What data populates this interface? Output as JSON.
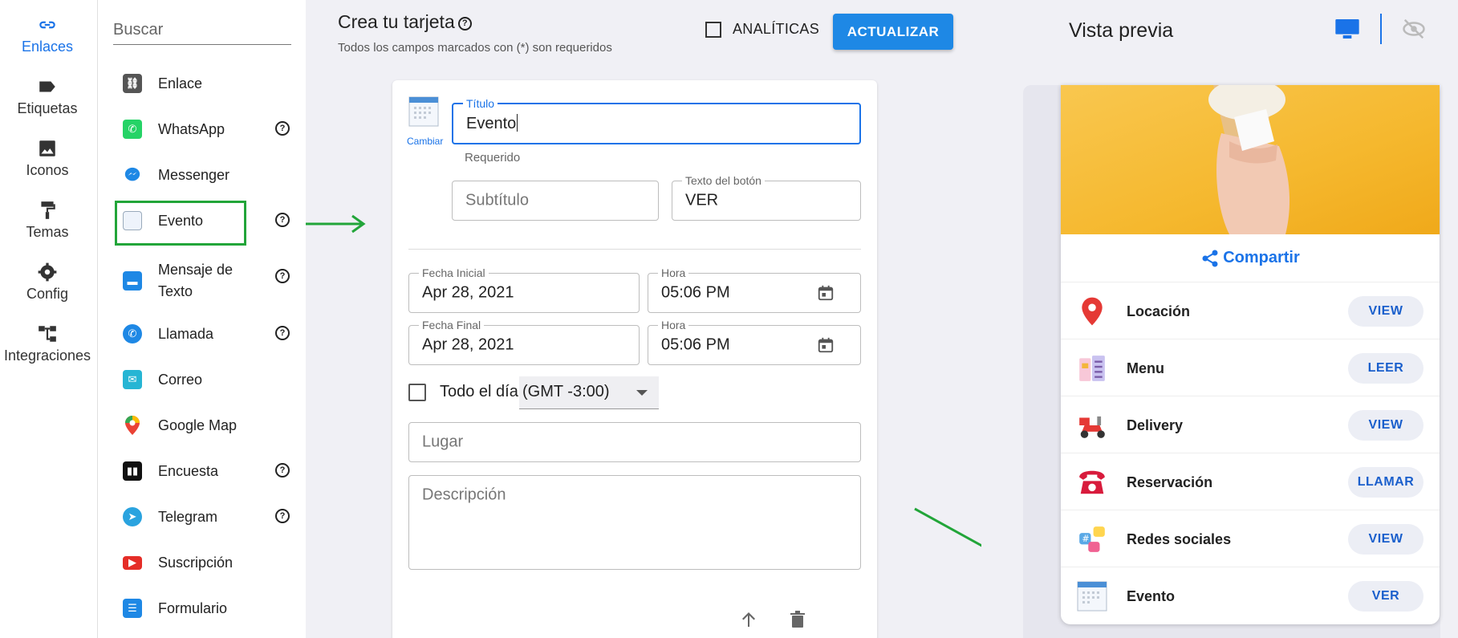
{
  "rail": {
    "items": [
      {
        "label": "Enlaces",
        "icon": "link-icon",
        "active": true
      },
      {
        "label": "Etiquetas",
        "icon": "tag-icon"
      },
      {
        "label": "Iconos",
        "icon": "image-icon"
      },
      {
        "label": "Temas",
        "icon": "paint-roller-icon"
      },
      {
        "label": "Config",
        "icon": "gear-icon"
      },
      {
        "label": "Integraciones",
        "icon": "hierarchy-icon"
      }
    ]
  },
  "types": {
    "search_placeholder": "Buscar",
    "items": [
      {
        "label": "Enlace",
        "icon": "link-icon",
        "color": "#555555"
      },
      {
        "label": "WhatsApp",
        "icon": "whatsapp-icon",
        "color": "#25d366",
        "help": true
      },
      {
        "label": "Messenger",
        "icon": "messenger-icon",
        "color": "#1e88e5"
      },
      {
        "label": "Evento",
        "icon": "calendar-icon",
        "color": "#e8eef8",
        "help": true
      },
      {
        "label": "Mensaje de",
        "label2": "Texto",
        "icon": "sms-icon",
        "color": "#1e88e5",
        "help": true
      },
      {
        "label": "Llamada",
        "icon": "phone-icon",
        "color": "#1e88e5",
        "help": true
      },
      {
        "label": "Correo",
        "icon": "mail-icon",
        "color": "#26b5d4"
      },
      {
        "label": "Google Map",
        "icon": "map-pin-icon",
        "color": "#ea4335"
      },
      {
        "label": "Encuesta",
        "icon": "poll-icon",
        "color": "#111111",
        "help": true
      },
      {
        "label": "Telegram",
        "icon": "telegram-icon",
        "color": "#2aa3df",
        "help": true
      },
      {
        "label": "Suscripción",
        "icon": "youtube-icon",
        "color": "#e52d27"
      },
      {
        "label": "Formulario",
        "icon": "form-icon",
        "color": "#1e88e5"
      }
    ]
  },
  "editor": {
    "title": "Crea tu tarjeta",
    "subtitle": "Todos los campos marcados con (*) son requeridos",
    "analytics_label": "ANALÍTICAS",
    "update_label": "ACTUALIZAR",
    "change_label": "Cambiar",
    "title_field": {
      "label": "Título",
      "value": "Evento",
      "helper": "Requerido"
    },
    "subtitle_field": {
      "placeholder": "Subtítulo"
    },
    "button_text_field": {
      "label": "Texto del botón",
      "value": "VER"
    },
    "start_date": {
      "label": "Fecha Inicial",
      "value": "Apr 28, 2021"
    },
    "start_time": {
      "label": "Hora",
      "value": "05:06 PM"
    },
    "end_date": {
      "label": "Fecha Final",
      "value": "Apr 28, 2021"
    },
    "end_time": {
      "label": "Hora",
      "value": "05:06 PM"
    },
    "all_day_label": "Todo el día",
    "timezone": "(GMT -3:00)",
    "place_placeholder": "Lugar",
    "description_placeholder": "Descripción"
  },
  "preview": {
    "title": "Vista previa",
    "share_label": "Compartir",
    "accent": "#1a73e8",
    "rows": [
      {
        "name": "Locación",
        "button": "VIEW",
        "icon": "location-pin-icon"
      },
      {
        "name": "Menu",
        "button": "LEER",
        "icon": "menu-icon"
      },
      {
        "name": "Delivery",
        "button": "VIEW",
        "icon": "scooter-icon"
      },
      {
        "name": "Reservación",
        "button": "LLAMAR",
        "icon": "telephone-icon"
      },
      {
        "name": "Redes sociales",
        "button": "VIEW",
        "icon": "social-icon"
      },
      {
        "name": "Evento",
        "button": "VER",
        "icon": "calendar-icon"
      }
    ]
  }
}
